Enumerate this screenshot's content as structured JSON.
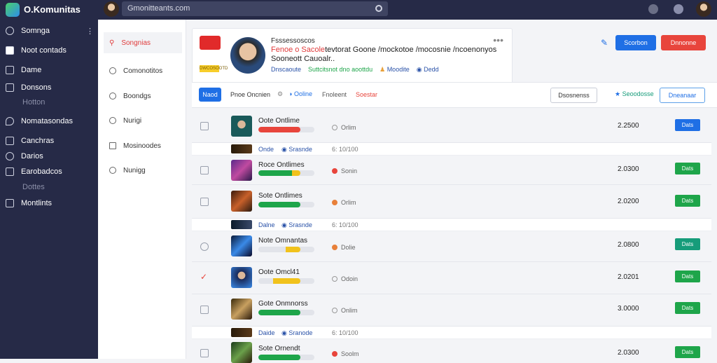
{
  "header": {
    "app_title": "O.Komunitas",
    "search_text": "Gmonitteants.com"
  },
  "sidebar": {
    "items": [
      {
        "label": "Somnga",
        "icon": "search-icon"
      },
      {
        "label": "Noot contads",
        "icon": "pen-icon"
      },
      {
        "label": "Dame",
        "icon": "camera-icon"
      },
      {
        "label": "Donsons",
        "icon": "calendar-icon"
      },
      {
        "label": "Hotton",
        "icon": ""
      },
      {
        "label": "Nomatasondas",
        "icon": "pin-icon"
      },
      {
        "label": "Canchras",
        "icon": "folder-icon"
      },
      {
        "label": "Darios",
        "icon": "pencil-icon"
      },
      {
        "label": "Earobadcos",
        "icon": "list-icon"
      },
      {
        "label": "Dottes",
        "icon": ""
      },
      {
        "label": "Montlints",
        "icon": "grid-icon"
      }
    ]
  },
  "panel": {
    "items": [
      "Songnias",
      "Comonotitos",
      "Boondgs",
      "Nurigi",
      "Mosinoodes",
      "Nunigg"
    ]
  },
  "profile": {
    "title": "Fsssessoscos",
    "line1_red": "Fenoe o Sacole",
    "line1_rest": "tevtorat Goone /mockotoe /mocosnie /ncoenonyos",
    "line2": "Sooneott Cauoalr..",
    "stat1": "Dnscaoute",
    "stat2": "Suttcitsnot dno aoottdu",
    "stat3": "Moodite",
    "stat4": "Dedd",
    "badge": "DWCOSOOTD",
    "more": "•••"
  },
  "actions": {
    "btn_blue": "Scorbon",
    "btn_red": "Dnnonne"
  },
  "controls": {
    "tab_active": "Naod",
    "label1": "Pnoe Oncnien",
    "label2": "Ooline",
    "label3": "Fnoleent",
    "label4": "Soestar",
    "outline1": "Dsosnenss",
    "star_label": "Seoodosse",
    "outline2": "Dneanaar"
  },
  "rows": [
    {
      "name": "Oote Ontlime",
      "status": "Orlim",
      "value": "2.2500",
      "button": "Dats",
      "fill": 0.75
    },
    {
      "name": "Roce Ontlimes",
      "status": "Sonin",
      "value": "2.0300",
      "button": "Dats",
      "fill": 0.75
    },
    {
      "name": "Sote Ontlimes",
      "status": "Orlim",
      "value": "2.0200",
      "button": "Dats",
      "fill": 0.75
    },
    {
      "name": "Note Omnantas",
      "status": "Dolie",
      "value": "2.0800",
      "button": "Dats",
      "fill": 0.75
    },
    {
      "name": "Oote Omcl41",
      "status": "Odoin",
      "value": "2.0201",
      "button": "Dats",
      "fill": 0.75
    },
    {
      "name": "Gote Onmnorss",
      "status": "Onlim",
      "value": "3.0000",
      "button": "Dats",
      "fill": 0.75
    },
    {
      "name": "Sote Ornendt",
      "status": "Soolm",
      "value": "2.0300",
      "button": "Dats",
      "fill": 0.75
    }
  ],
  "subrows": [
    {
      "a": "Onde",
      "b": "Srasnde",
      "c": "6: 10/100"
    },
    {
      "a": "Dalne",
      "b": "Srasnde",
      "c": "6: 10/100"
    },
    {
      "a": "Daide",
      "b": "Sranode",
      "c": "6: 10/100"
    }
  ],
  "colors": {
    "sidebar": "#262a47",
    "blue": "#1f6fe5",
    "red": "#e8453c",
    "green": "#1ea54a",
    "teal": "#169c7a"
  }
}
